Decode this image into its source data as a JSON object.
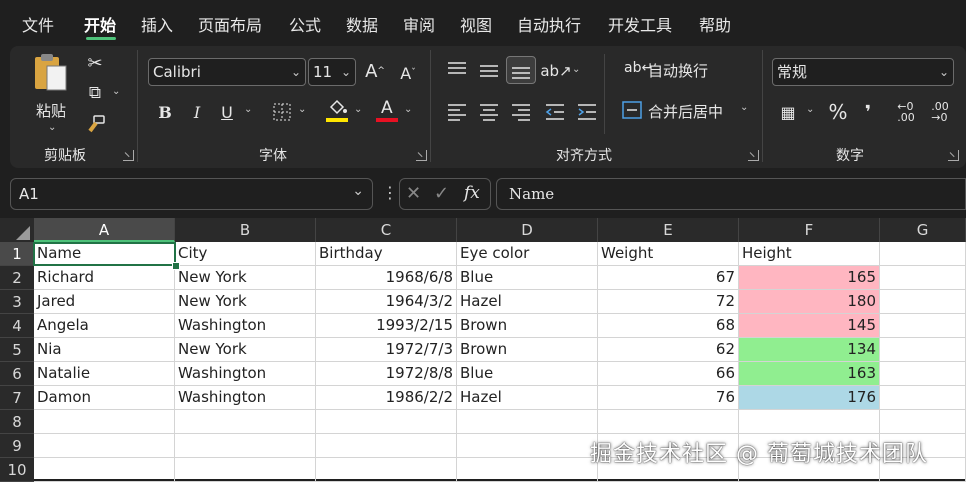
{
  "menu": {
    "items": [
      "文件",
      "开始",
      "插入",
      "页面布局",
      "公式",
      "数据",
      "审阅",
      "视图",
      "自动执行",
      "开发工具",
      "帮助"
    ],
    "active": "开始"
  },
  "ribbon": {
    "clipboard": {
      "paste_label": "粘贴",
      "group_label": "剪贴板"
    },
    "font": {
      "font_name": "Calibri",
      "font_size": "11",
      "group_label": "字体",
      "bold": "B",
      "italic": "I",
      "underline": "U",
      "highlight_color": "#ffe600",
      "font_color": "#e81123"
    },
    "alignment": {
      "wrap_text": "自动换行",
      "merge_center": "合并后居中",
      "group_label": "对齐方式"
    },
    "number": {
      "format": "常规",
      "group_label": "数字",
      "percent": "%",
      "comma": "❜"
    }
  },
  "formula_bar": {
    "name_box": "A1",
    "formula": "Name",
    "fx": "fx"
  },
  "sheet": {
    "columns": [
      "A",
      "B",
      "C",
      "D",
      "E",
      "F",
      "G"
    ],
    "rows": [
      "1",
      "2",
      "3",
      "4",
      "5",
      "6",
      "7",
      "8",
      "9",
      "10"
    ],
    "header": [
      "Name",
      "City",
      "Birthday",
      "Eye color",
      "Weight",
      "Height"
    ],
    "data": [
      [
        "Richard",
        "New York",
        "1968/6/8",
        "Blue",
        "67",
        "165"
      ],
      [
        "Jared",
        "New York",
        "1964/3/2",
        "Hazel",
        "72",
        "180"
      ],
      [
        "Angela",
        "Washington",
        "1993/2/15",
        "Brown",
        "68",
        "145"
      ],
      [
        "Nia",
        "New York",
        "1972/7/3",
        "Brown",
        "62",
        "134"
      ],
      [
        "Natalie",
        "Washington",
        "1972/8/8",
        "Blue",
        "66",
        "163"
      ],
      [
        "Damon",
        "Washington",
        "1986/2/2",
        "Hazel",
        "76",
        "176"
      ]
    ],
    "height_fill": [
      "pink",
      "pink",
      "pink",
      "green",
      "green",
      "blue"
    ],
    "fill_colors": {
      "pink": "#ffb6c1",
      "green": "#90ee90",
      "blue": "#add8e6"
    },
    "selected_cell": "A1"
  },
  "watermark": "掘金技术社区 @ 葡萄城技术团队"
}
